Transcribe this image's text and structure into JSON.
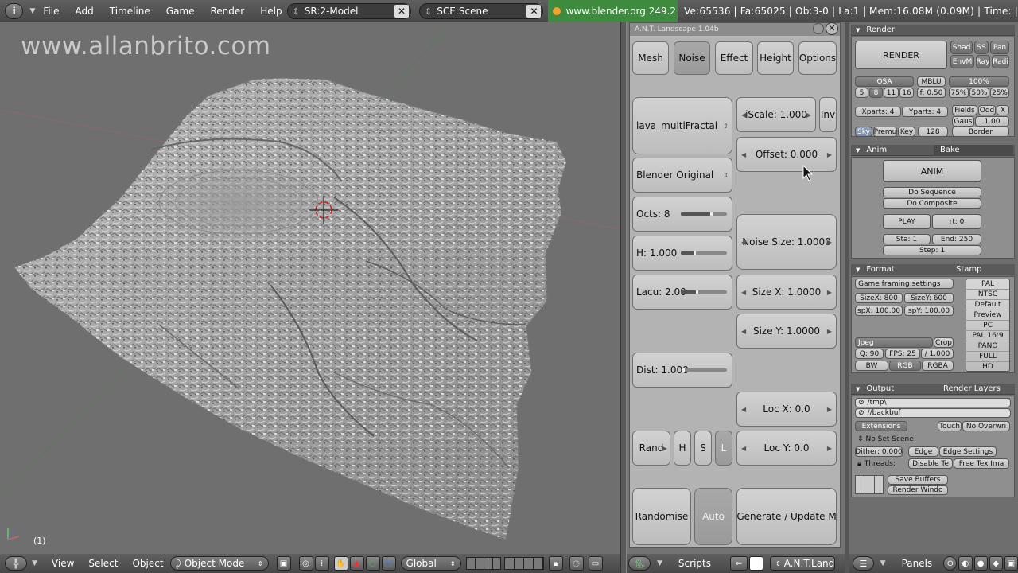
{
  "topbar": {
    "menus": [
      "File",
      "Add",
      "Timeline",
      "Game",
      "Render",
      "Help"
    ],
    "screen_field": "SR:2-Model",
    "scene_field": "SCE:Scene",
    "url": "www.blender.org 249.2",
    "stats": "Ve:65536 | Fa:65025 | Ob:3-0 | La:1  | Mem:16.08M (0.09M)  | Time: |"
  },
  "viewport": {
    "watermark": "www.allanbrito.com",
    "frame": "(1)"
  },
  "view3d_header": {
    "menus": [
      "View",
      "Select",
      "Object"
    ],
    "mode": "Object Mode",
    "orientation": "Global"
  },
  "ant": {
    "title": "A.N.T. Landscape 1.04b",
    "tabs": [
      "Mesh",
      "Noise",
      "Effect",
      "Height",
      "Options"
    ],
    "active_tab": "Noise",
    "noise_type": "lava_multiFractal",
    "noise_basis": "Blender Original",
    "iscale": "iScale: 1.000",
    "inv": "Inv",
    "offset": "Offset: 0.000",
    "octs": "Octs: 8",
    "octs_level": 0.65,
    "h": "H: 1.000",
    "h_level": 0.3,
    "lacu": "Lacu: 2.00",
    "lacu_level": 0.35,
    "noise_size": "Noise Size: 1.0000",
    "size_x": "Size X: 1.0000",
    "size_y": "Size Y: 1.0000",
    "dist": "Dist: 1.000",
    "dist_level": 0.05,
    "loc_x": "Loc X: 0.0",
    "loc_y": "Loc Y: 0.0",
    "rand": "Rand",
    "h_btn": "H",
    "s_btn": "S",
    "l_btn": "L",
    "randomise": "Randomise",
    "auto": "Auto",
    "generate": "Generate / Update M"
  },
  "scripts_header": {
    "menu": "Scripts",
    "script_name": "A.N.T.Land"
  },
  "props": {
    "render_header": "Render",
    "render_btn": "RENDER",
    "shad": "Shad",
    "ss": "SS",
    "pan": "Pan",
    "envm": "EnvM",
    "ray": "Ray",
    "radi": "Radi",
    "osa": "OSA",
    "mblu": "MBLU",
    "pct100": "100%",
    "osa_vals": [
      "5",
      "8",
      "11",
      "16"
    ],
    "mblu_val": "f: 0.50",
    "pct_vals": [
      "75%",
      "50%",
      "25%"
    ],
    "xparts": "Xparts: 4",
    "yparts": "Yparts: 4",
    "fields": "Fields",
    "odd": "Odd",
    "x": "X",
    "gaus": "Gaus",
    "gaus_val": "1.00",
    "sky": "Sky",
    "premu": "Premu",
    "key": "Key",
    "key_val": "128",
    "border": "Border",
    "anim_header": "Anim",
    "bake_header": "Bake",
    "anim_btn": "ANIM",
    "do_sequence": "Do Sequence",
    "do_composite": "Do Composite",
    "play": "PLAY",
    "rt": "rt: 0",
    "sta": "Sta: 1",
    "end": "End: 250",
    "step": "Step: 1",
    "format_header": "Format",
    "stamp_header": "Stamp",
    "game_framing": "Game framing settings",
    "sizex": "SizeX: 800",
    "sizey": "SizeY: 600",
    "spx": "spX: 100.00",
    "spy": "spY: 100.00",
    "presets": [
      "PAL",
      "NTSC",
      "Default",
      "Preview",
      "PC",
      "PAL 16:9",
      "PANO",
      "FULL",
      "HD"
    ],
    "jpeg": "Jpeg",
    "crop": "Crop",
    "q": "Q: 90",
    "fps": "FPS: 25",
    "fps_div": "/ 1.000",
    "bw": "BW",
    "rgb": "RGB",
    "rgba": "RGBA",
    "output_header": "Output",
    "render_layers_header": "Render Layers",
    "path1": "/tmp\\",
    "path2": "//backbuf",
    "extensions": "Extensions",
    "touch": "Touch",
    "no_overwri": "No Overwri",
    "no_set_scene": "No Set Scene",
    "dither": "Dither: 0.000",
    "edge": "Edge",
    "edge_settings": "Edge Settings",
    "threads": "Threads:",
    "disable_te": "Disable Te",
    "free_tex": "Free Tex Ima",
    "save_buffers": "Save Buffers",
    "render_window": "Render Windo"
  },
  "panels_header": {
    "menu": "Panels"
  }
}
